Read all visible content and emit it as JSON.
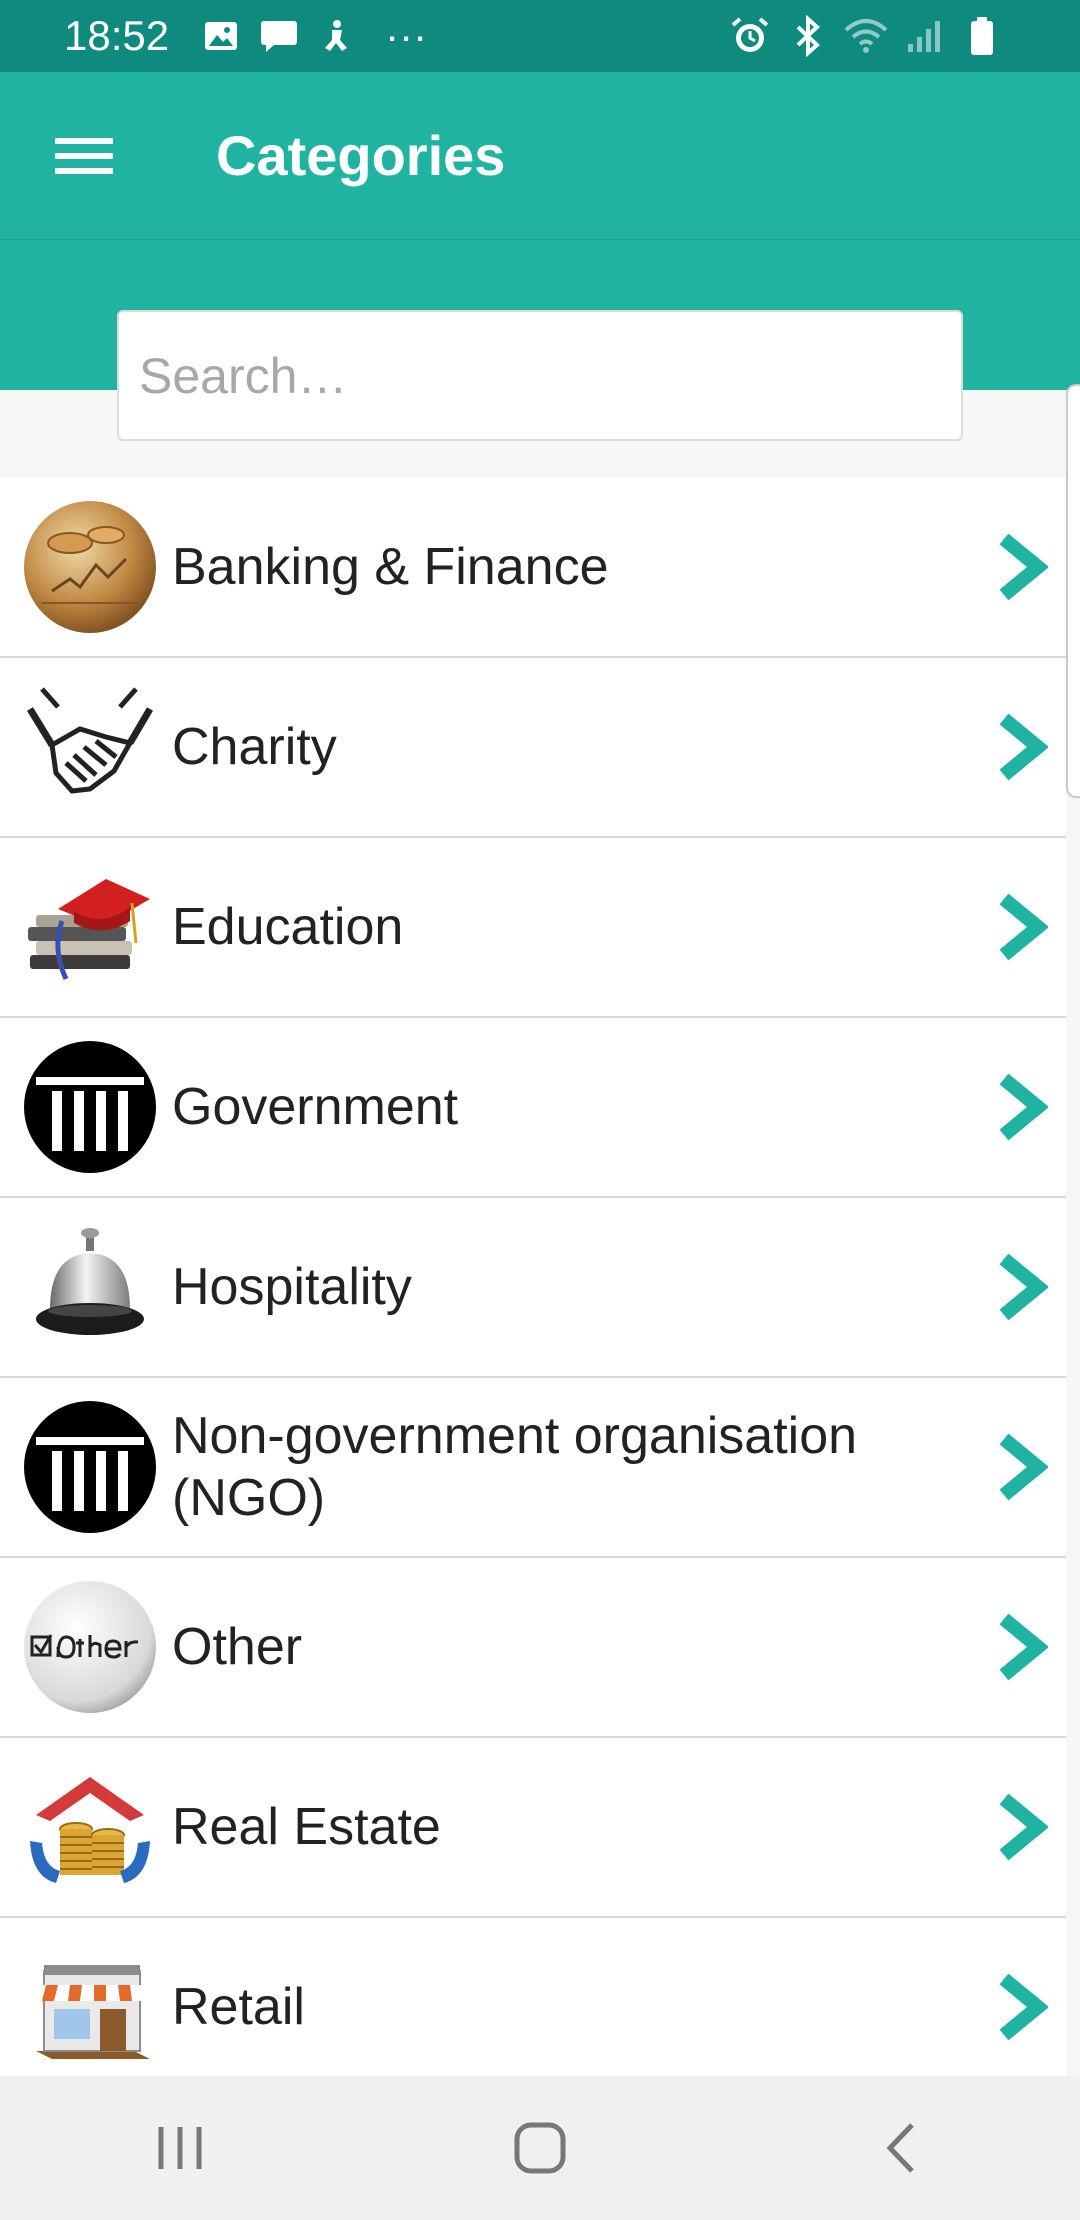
{
  "status_bar": {
    "time": "18:52",
    "more": "···"
  },
  "app_bar": {
    "title": "Categories"
  },
  "search": {
    "placeholder": "Search…",
    "value": ""
  },
  "categories": [
    {
      "label": "Banking & Finance",
      "icon": "coins-icon"
    },
    {
      "label": "Charity",
      "icon": "handshake-icon"
    },
    {
      "label": "Education",
      "icon": "graduation-cap-books-icon"
    },
    {
      "label": "Government",
      "icon": "columns-building-icon"
    },
    {
      "label": "Hospitality",
      "icon": "service-bell-icon"
    },
    {
      "label": "Non-government organisation (NGO)",
      "icon": "columns-building-icon"
    },
    {
      "label": "Other",
      "icon": "other-badge-icon"
    },
    {
      "label": "Real Estate",
      "icon": "house-coins-icon"
    },
    {
      "label": "Retail",
      "icon": "storefront-icon"
    }
  ],
  "colors": {
    "status_bar": "#0e8a7e",
    "app_bar": "#20b3a1",
    "chevron": "#20b3a1"
  }
}
